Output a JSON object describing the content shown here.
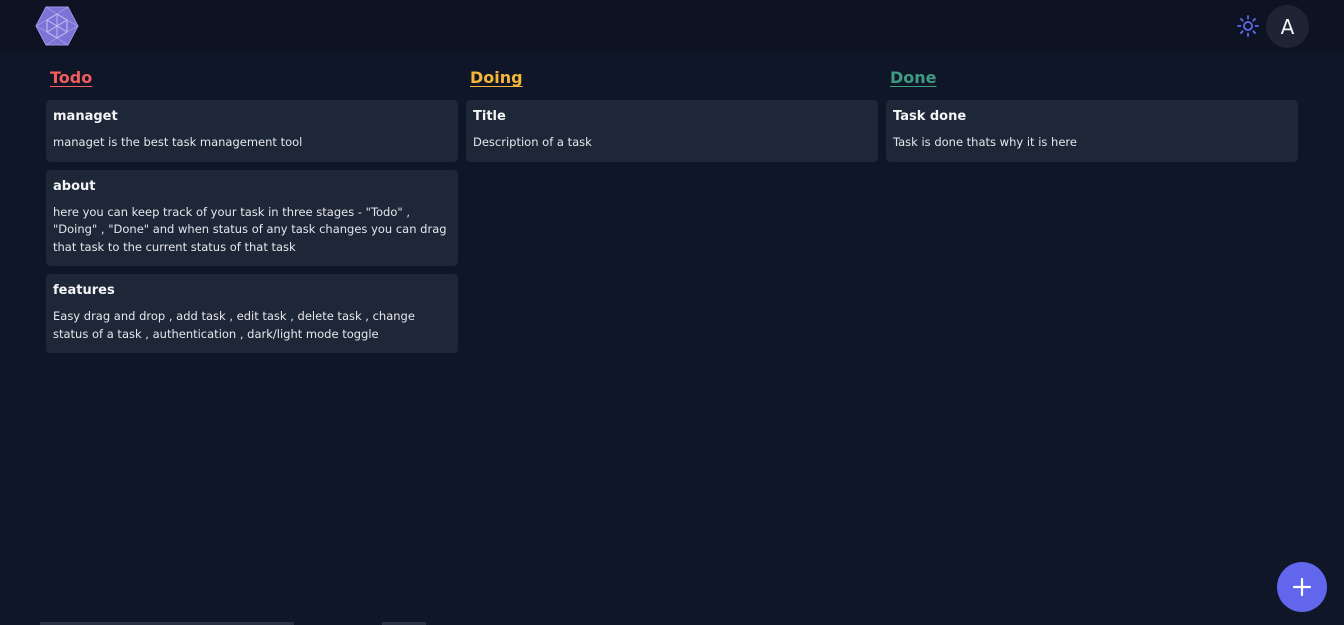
{
  "header": {
    "logo_icon": "hexagon-cube-logo",
    "theme_toggle_icon": "sun-icon",
    "avatar_initial": "A"
  },
  "columns": [
    {
      "title": "Todo",
      "color": "#f25c5c",
      "cards": [
        {
          "title": "managet",
          "description": "managet is the best task management tool"
        },
        {
          "title": "about",
          "description": "here you can keep track of your task in three stages - \"Todo\" , \"Doing\" , \"Done\" and when status of any task changes you can drag that task to the current status of that task"
        },
        {
          "title": "features",
          "description": "Easy drag and drop , add task , edit task , delete task , change status of a task , authentication , dark/light mode toggle"
        }
      ]
    },
    {
      "title": "Doing",
      "color": "#f5b638",
      "cards": [
        {
          "title": "Title",
          "description": "Description of a task"
        }
      ]
    },
    {
      "title": "Done",
      "color": "#3f9c84",
      "cards": [
        {
          "title": "Task done",
          "description": "Task is done thats why it is here"
        }
      ]
    }
  ],
  "fab": {
    "icon": "plus-icon",
    "color": "#6166ec"
  },
  "colors": {
    "background": "#0f1627",
    "card": "#1e2738",
    "accent": "#6166ec"
  }
}
